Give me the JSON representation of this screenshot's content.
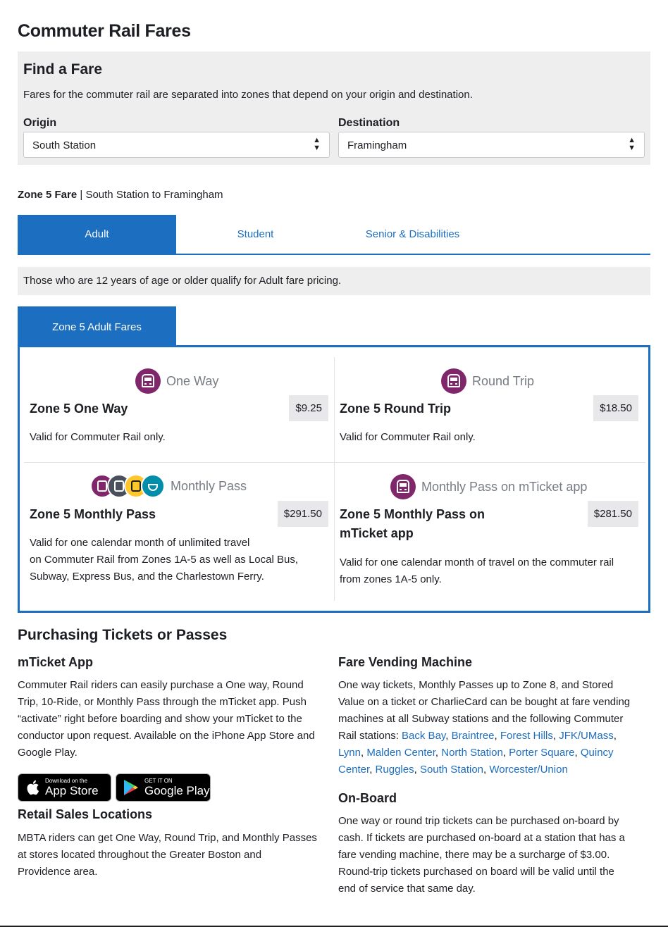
{
  "page_title": "Commuter Rail Fares",
  "find_fare": {
    "heading": "Find a Fare",
    "description": "Fares for the commuter rail are separated into zones that depend on your origin and destination.",
    "origin_label": "Origin",
    "origin_value": "South Station",
    "destination_label": "Destination",
    "destination_value": "Framingham"
  },
  "zone_summary": {
    "zone": "Zone 5 Fare",
    "separator": "|",
    "route": "South Station to Framingham"
  },
  "rider_tabs": [
    {
      "label": "Adult",
      "active": true
    },
    {
      "label": "Student",
      "active": false
    },
    {
      "label": "Senior & Disabilities",
      "active": false
    }
  ],
  "eligibility_note": "Those who are 12 years of age or older qualify for Adult fare pricing.",
  "fares_tab_label": "Zone 5 Adult Fares",
  "fares": [
    {
      "icon_label": "One Way",
      "name": "Zone 5 One Way",
      "price": "$9.25",
      "description": "Valid for Commuter Rail only.",
      "icons": [
        "commuter-rail-icon"
      ]
    },
    {
      "icon_label": "Round Trip",
      "name": "Zone 5 Round Trip",
      "price": "$18.50",
      "description": "Valid for Commuter Rail only.",
      "icons": [
        "commuter-rail-icon"
      ]
    },
    {
      "icon_label": "Monthly Pass",
      "name": "Zone 5 Monthly Pass",
      "price": "$291.50",
      "description_lines": [
        "Valid for one calendar month of unlimited travel",
        "on Commuter Rail from Zones 1A-5 as well as Local Bus,",
        "Subway, Express Bus, and the Charlestown Ferry."
      ],
      "icons": [
        "commuter-rail-icon",
        "subway-icon",
        "bus-icon",
        "ferry-icon"
      ]
    },
    {
      "icon_label": "Monthly Pass on mTicket app",
      "name_lines": [
        "Zone 5 Monthly Pass on",
        "mTicket app"
      ],
      "price": "$281.50",
      "description_lines": [
        "Valid for one calendar month of travel on the commuter rail",
        "from zones 1A-5 only."
      ],
      "icons": [
        "commuter-rail-icon"
      ]
    }
  ],
  "purchasing": {
    "heading": "Purchasing Tickets or Passes",
    "mticket": {
      "heading": "mTicket App",
      "lines": [
        "Commuter Rail riders can easily purchase a One way, Round",
        "Trip, 10-Ride, or Monthly Pass through the mTicket app. Push",
        "“activate” right before boarding and show your mTicket to the",
        "conductor upon request. Available on the iPhone App Store and",
        "Google Play."
      ]
    },
    "app_store": {
      "small": "Download on the",
      "big": "App Store"
    },
    "google_play": {
      "small": "GET IT ON",
      "big": "Google Play"
    },
    "retail": {
      "heading": "Retail Sales Locations",
      "lines": [
        "MBTA riders can get One Way, Round Trip, and Monthly Passes",
        "at stores located throughout the Greater Boston and",
        "Providence area."
      ]
    },
    "vending": {
      "heading": "Fare Vending Machine",
      "lines": [
        "One way tickets, Monthly Passes up to Zone 8, and Stored",
        "Value on a ticket or CharlieCard can be bought at fare vending",
        "machines at all Subway stations and the following Commuter"
      ],
      "line4_prefix": "Rail stations: ",
      "stations": [
        "Back Bay",
        "Braintree",
        "Forest Hills",
        "JFK/UMass",
        "Lynn",
        "Malden Center",
        "North Station",
        "Porter Square",
        "Quincy Center",
        "Ruggles",
        "South Station",
        "Worcester/Union"
      ]
    },
    "onboard": {
      "heading": "On-Board",
      "lines": [
        "One way or round trip tickets can be purchased on-board by",
        "cash. If tickets are purchased on-board at a station that has a",
        "fare vending machine, there may be a surcharge of $3.00.",
        "Round-trip tickets purchased on board will be valid until the",
        "end of service that same day."
      ]
    }
  },
  "colors": {
    "accent": "#1c6ec0",
    "commuter_rail": "#80276c",
    "subway": "#494f5c",
    "bus": "#ffc72c",
    "ferry": "#008eaa",
    "panel": "#eeeeef"
  }
}
